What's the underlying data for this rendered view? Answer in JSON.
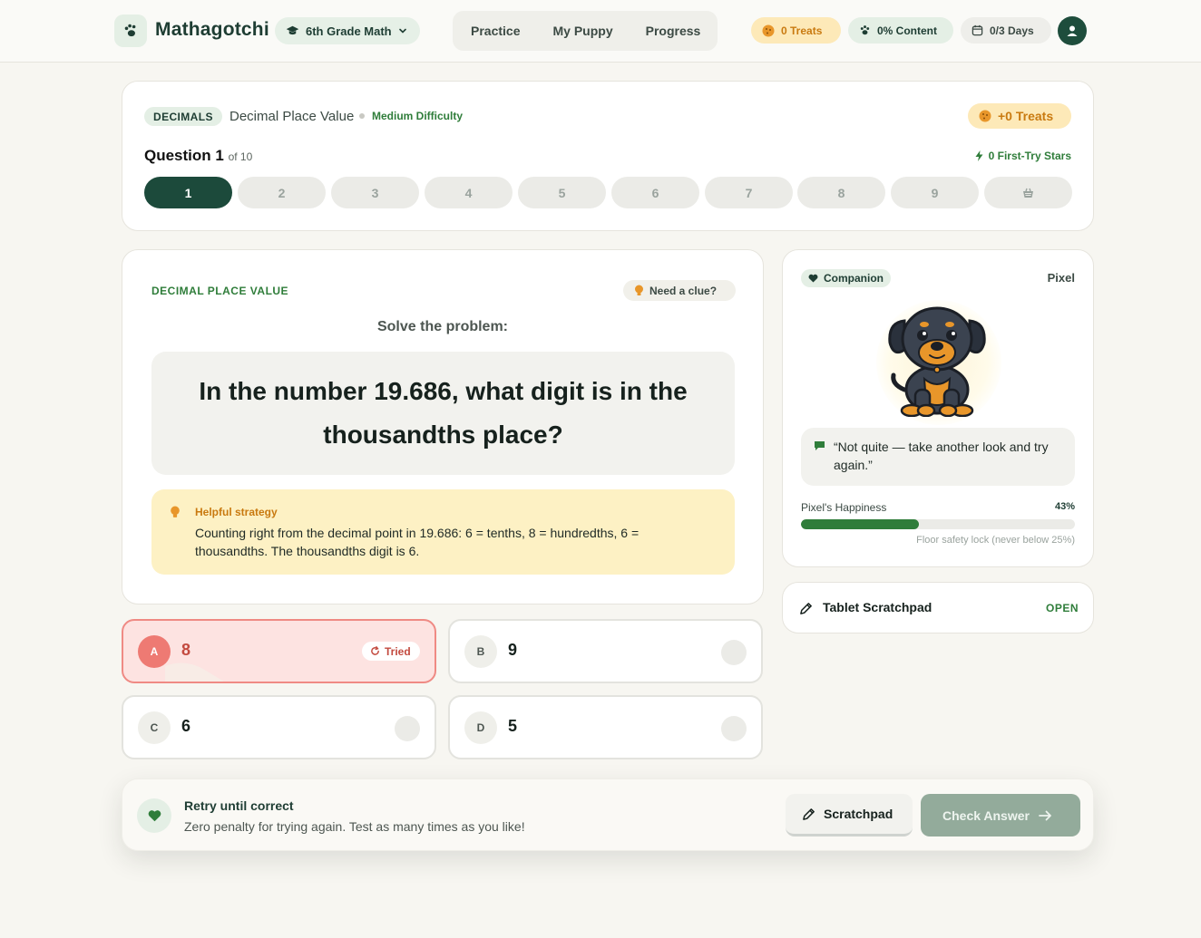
{
  "header": {
    "brand": "Mathagotchi",
    "grade": "6th Grade Math",
    "nav": [
      "Practice",
      "My Puppy",
      "Progress"
    ],
    "treats": "0 Treats",
    "content": "0% Content",
    "days": "0/3 Days"
  },
  "quiz": {
    "tag": "DECIMALS",
    "topic": "Decimal Place Value",
    "difficulty": "Medium Difficulty",
    "bonus": "+0 Treats",
    "question_label": "Question 1",
    "question_of": "of 10",
    "stars": "0 First-Try Stars",
    "steps": [
      "1",
      "2",
      "3",
      "4",
      "5",
      "6",
      "7",
      "8",
      "9"
    ],
    "active_step": 1
  },
  "problem": {
    "label": "DECIMAL PLACE VALUE",
    "clue": "Need a clue?",
    "instruction": "Solve the problem:",
    "question": "In the number 19.686, what digit is in the thousandths place?",
    "strategy_title": "Helpful strategy",
    "strategy_body": "Counting right from the decimal point in 19.686: 6 = tenths, 8 = hundredths, 6 = thousandths. The thousandths digit is 6."
  },
  "answers": [
    {
      "letter": "A",
      "value": "8",
      "status": "tried",
      "badge": "Tried"
    },
    {
      "letter": "B",
      "value": "9",
      "status": "none"
    },
    {
      "letter": "C",
      "value": "6",
      "status": "none"
    },
    {
      "letter": "D",
      "value": "5",
      "status": "none"
    }
  ],
  "companion": {
    "tag": "Companion",
    "name": "Pixel",
    "speech": "“Not quite — take another look and try again.”",
    "happiness_label": "Pixel's Happiness",
    "happiness_value": "43%",
    "happiness_fraction": 0.43,
    "floor_note": "Floor safety lock (never below 25%)"
  },
  "scratchpad_card": {
    "title": "Tablet Scratchpad",
    "action": "OPEN"
  },
  "footer": {
    "title": "Retry until correct",
    "body": "Zero penalty for trying again. Test as many times as you like!",
    "scratch_button": "Scratchpad",
    "check_button": "Check Answer"
  },
  "colors": {
    "brand_dark": "#1c4a3b",
    "accent_green": "#2f7d3a",
    "treat_orange": "#c97a10",
    "error_red": "#ee7a73"
  },
  "icons": [
    "paw-icon",
    "graduation-cap-icon",
    "chevron-down-icon",
    "cookie-icon",
    "paw-icon",
    "calendar-icon",
    "user-icon",
    "lightning-icon",
    "basket-icon",
    "lightbulb-icon",
    "heart-icon",
    "chat-icon",
    "pencil-icon",
    "arrow-right-icon",
    "retry-icon"
  ]
}
